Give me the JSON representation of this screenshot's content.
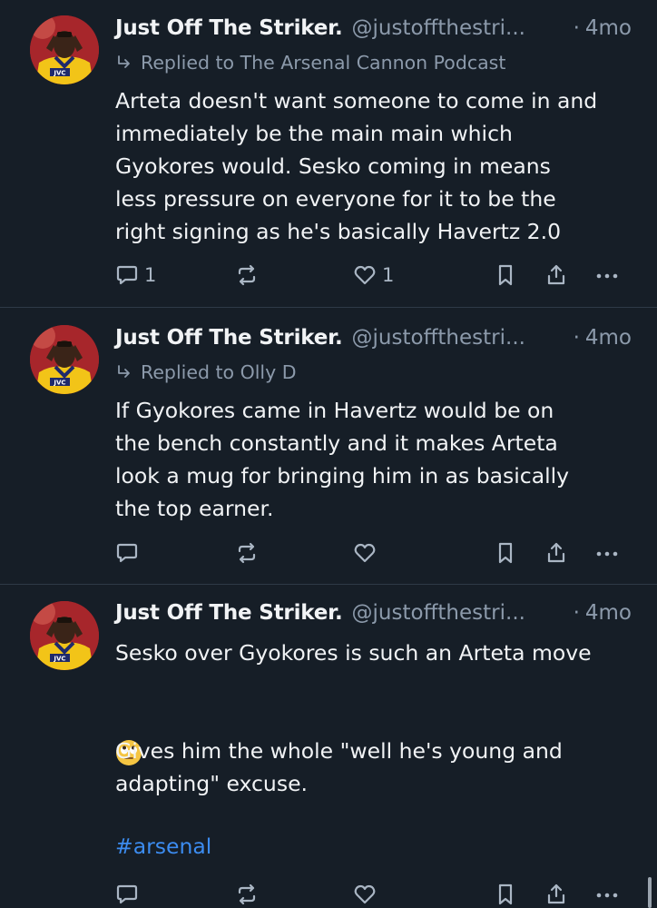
{
  "posts": [
    {
      "author_name": "Just Off The Striker.",
      "handle": "@justoffthestri...",
      "separator": "·",
      "time": "4mo",
      "replied_to": "Replied to The Arsenal Cannon Podcast",
      "text": "Arteta doesn't want someone to come in and\nimmediately be the main main which\nGyokores would. Sesko coming in means\nless pressure on everyone for it to be the\nright signing as he's basically Havertz 2.0",
      "reply_count": "1",
      "like_count": "1"
    },
    {
      "author_name": "Just Off The Striker.",
      "handle": "@justoffthestri...",
      "separator": "·",
      "time": "4mo",
      "replied_to": "Replied to Olly D",
      "text": "If Gyokores came in Havertz would be on\nthe bench constantly and it makes Arteta\nlook a mug for bringing him in as basically\nthe top earner.",
      "reply_count": "",
      "like_count": ""
    },
    {
      "author_name": "Just Off The Striker.",
      "handle": "@justoffthestri...",
      "separator": "·",
      "time": "4mo",
      "text_line1": "Sesko over Gyokores is such an Arteta move",
      "emoji": "face-with-rolling-eyes-emoji",
      "text_rest": "Gives him the whole \"well he's young and\nadapting\" excuse.",
      "hashtag": "#arsenal",
      "reply_count": "",
      "like_count": ""
    }
  ],
  "avatar": {
    "jersey_text": "JVC",
    "jersey_color": "#f2c418",
    "bg_color": "#9a1f24"
  },
  "colors": {
    "background": "#161e27",
    "divider": "#2e3a47",
    "muted": "#8c9aab",
    "link": "#3c8cf0"
  },
  "icons": [
    "reply-icon",
    "repost-icon",
    "like-icon",
    "bookmark-icon",
    "share-icon",
    "more-icon",
    "replied-arrow-icon"
  ]
}
